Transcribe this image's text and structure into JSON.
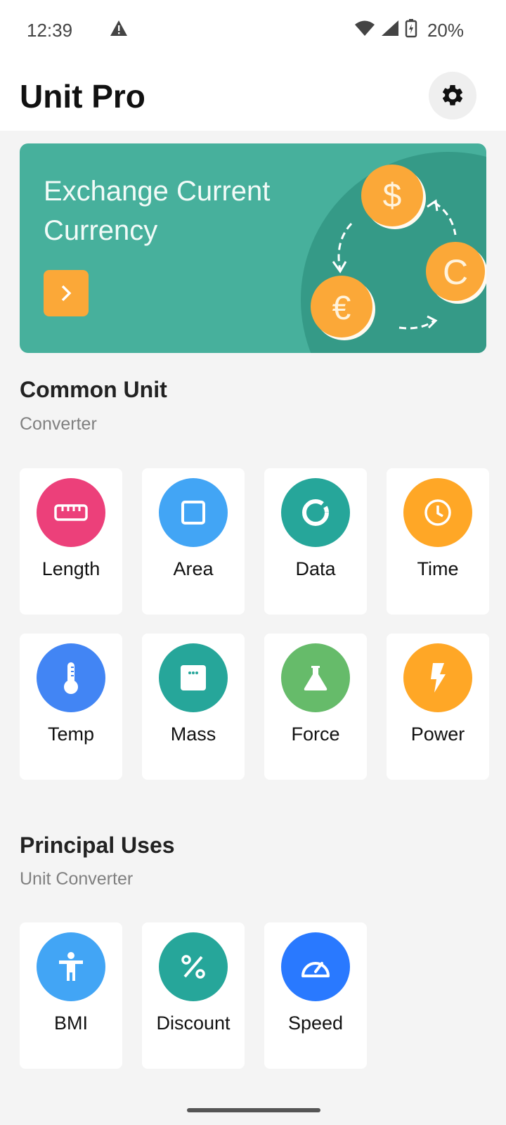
{
  "status": {
    "time": "12:39",
    "battery": "20%"
  },
  "app": {
    "title": "Unit Pro"
  },
  "banner": {
    "text": "Exchange Current Currency"
  },
  "common": {
    "title": "Common Unit",
    "subtitle": "Converter",
    "items": [
      {
        "label": "Length",
        "color": "#ec407a",
        "icon": "ruler-icon"
      },
      {
        "label": "Area",
        "color": "#42a5f5",
        "icon": "square-icon"
      },
      {
        "label": "Data",
        "color": "#26a69a",
        "icon": "donut-icon"
      },
      {
        "label": "Time",
        "color": "#ffa726",
        "icon": "clock-icon"
      },
      {
        "label": "Temp",
        "color": "#4285f4",
        "icon": "thermometer-icon"
      },
      {
        "label": "Mass",
        "color": "#26a69a",
        "icon": "scale-icon"
      },
      {
        "label": "Force",
        "color": "#66bb6a",
        "icon": "flask-icon"
      },
      {
        "label": "Power",
        "color": "#ffa726",
        "icon": "bolt-icon"
      }
    ]
  },
  "principal": {
    "title": "Principal Uses",
    "subtitle": "Unit Converter",
    "items": [
      {
        "label": "BMI",
        "color": "#42a5f5",
        "icon": "person-icon"
      },
      {
        "label": "Discount",
        "color": "#26a69a",
        "icon": "percent-icon"
      },
      {
        "label": "Speed",
        "color": "#2979ff",
        "icon": "speedometer-icon"
      }
    ]
  }
}
